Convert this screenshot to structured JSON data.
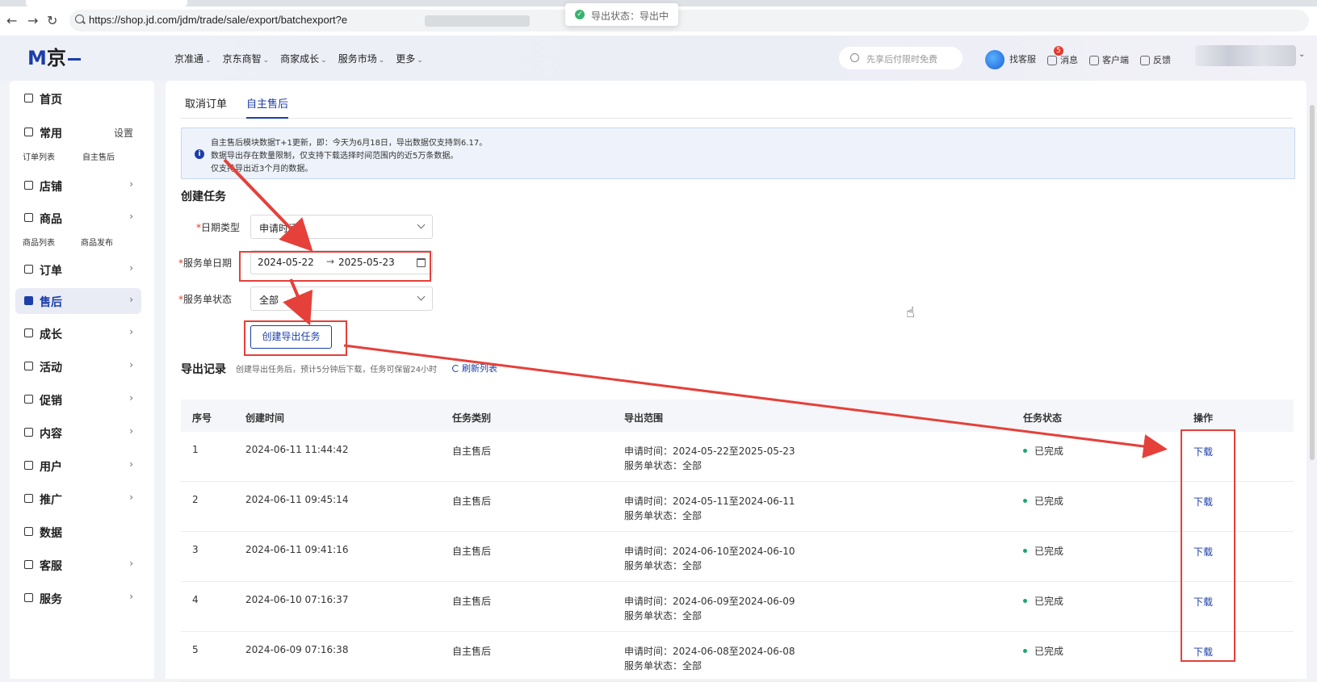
{
  "browser": {
    "url": "https://shop.jd.com/jdm/trade/sale/export/batchexport?e"
  },
  "toast": {
    "text": "导出状态：导出中"
  },
  "header": {
    "logo_letter": "M",
    "logo_text": "京",
    "nav": [
      "京准通",
      "京东商智",
      "商家成长",
      "服务市场",
      "更多"
    ],
    "search_placeholder": "先享后付限时免费",
    "tools": {
      "service": "找客服",
      "messages": "消息",
      "message_count": "5",
      "client": "客户端",
      "feedback": "反馈"
    }
  },
  "sidebar": {
    "items": [
      {
        "label": "首页"
      },
      {
        "label": "常用",
        "extra": "设置"
      },
      {
        "label": "店铺"
      },
      {
        "label": "商品"
      },
      {
        "label": "订单"
      },
      {
        "label": "售后"
      },
      {
        "label": "成长"
      },
      {
        "label": "活动"
      },
      {
        "label": "促销"
      },
      {
        "label": "内容"
      },
      {
        "label": "用户"
      },
      {
        "label": "推广"
      },
      {
        "label": "数据"
      },
      {
        "label": "客服"
      },
      {
        "label": "服务"
      }
    ],
    "common_links": [
      "订单列表",
      "自主售后"
    ],
    "product_links": [
      "商品列表",
      "商品发布"
    ]
  },
  "tabs": [
    "取消订单",
    "自主售后"
  ],
  "notice": [
    "自主售后模块数据T+1更新，即：今天为6月18日，导出数据仅支持到6.17。",
    "数据导出存在数量限制，仅支持下载选择时间范围内的近5万条数据。",
    "仅支持导出近3个月的数据。"
  ],
  "form": {
    "title": "创建任务",
    "date_type_label": "日期类型",
    "date_type_value": "申请时间",
    "date_range_label": "服务单日期",
    "date_start": "2024-05-22",
    "date_sep": "→",
    "date_end": "2025-05-23",
    "status_label": "服务单状态",
    "status_value": "全部",
    "submit": "创建导出任务"
  },
  "records": {
    "title": "导出记录",
    "desc": "创建导出任务后，预计5分钟后下载，任务可保留24小时",
    "refresh": "刷新列表",
    "columns": [
      "序号",
      "创建时间",
      "任务类别",
      "导出范围",
      "任务状态",
      "操作"
    ],
    "rows": [
      {
        "no": "1",
        "time": "2024-06-11 11:44:42",
        "type": "自主售后",
        "range": "申请时间：2024-05-22至2025-05-23",
        "scope": "服务单状态：全部",
        "status": "已完成",
        "action": "下载"
      },
      {
        "no": "2",
        "time": "2024-06-11 09:45:14",
        "type": "自主售后",
        "range": "申请时间：2024-05-11至2024-06-11",
        "scope": "服务单状态：全部",
        "status": "已完成",
        "action": "下载"
      },
      {
        "no": "3",
        "time": "2024-06-11 09:41:16",
        "type": "自主售后",
        "range": "申请时间：2024-06-10至2024-06-10",
        "scope": "服务单状态：全部",
        "status": "已完成",
        "action": "下载"
      },
      {
        "no": "4",
        "time": "2024-06-10 07:16:37",
        "type": "自主售后",
        "range": "申请时间：2024-06-09至2024-06-09",
        "scope": "服务单状态：全部",
        "status": "已完成",
        "action": "下载"
      },
      {
        "no": "5",
        "time": "2024-06-09 07:16:38",
        "type": "自主售后",
        "range": "申请时间：2024-06-08至2024-06-08",
        "scope": "服务单状态：全部",
        "status": "已完成",
        "action": "下载"
      }
    ]
  },
  "colors": {
    "accent": "#1b3ea9",
    "annotation": "#e5403a",
    "success": "#1aa86b"
  }
}
